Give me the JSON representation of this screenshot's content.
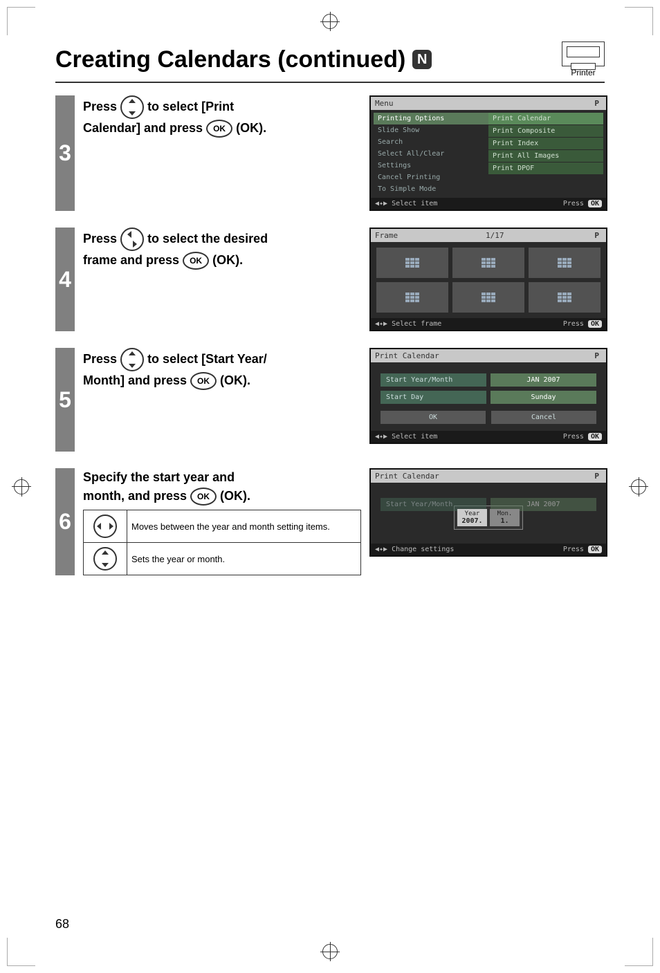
{
  "title": "Creating Calendars (continued)",
  "badge": "N",
  "printer_label": "Printer",
  "page_number": "68",
  "steps": {
    "s3": {
      "num": "3",
      "line1_a": "Press ",
      "line1_b": " to select [Print",
      "line2_a": "Calendar] and press ",
      "line2_b": " (OK).",
      "ok_inner": "OK"
    },
    "s4": {
      "num": "4",
      "line1_a": "Press ",
      "line1_b": " to select the desired",
      "line2_a": "frame and press ",
      "line2_b": " (OK).",
      "ok_inner": "OK"
    },
    "s5": {
      "num": "5",
      "line1_a": "Press ",
      "line1_b": " to select [Start Year/",
      "line2_a": "Month] and press ",
      "line2_b": " (OK).",
      "ok_inner": "OK"
    },
    "s6": {
      "num": "6",
      "line1": "Specify the start year and",
      "line2_a": "month, and press ",
      "line2_b": " (OK).",
      "ok_inner": "OK",
      "row1": "Moves between the year and month setting items.",
      "row2": "Sets the year or month."
    }
  },
  "shots": {
    "menu": {
      "header": "Menu",
      "p": "P",
      "left": [
        "Printing Options",
        "Slide Show",
        "Search",
        "Select All/Clear",
        "Settings",
        "Cancel Printing",
        "To Simple Mode"
      ],
      "right": [
        "Print Calendar",
        "Print Composite",
        "Print Index",
        "Print All Images",
        "Print DPOF"
      ],
      "footer_left": "◀✦▶ Select item",
      "footer_right_a": "Press",
      "footer_right_b": "OK"
    },
    "frame": {
      "header": "Frame",
      "count": "1/17",
      "p": "P",
      "footer_left": "◀✦▶ Select frame",
      "footer_right_a": "Press",
      "footer_right_b": "OK"
    },
    "pc1": {
      "header": "Print Calendar",
      "p": "P",
      "r1_lbl": "Start Year/Month",
      "r1_val": "JAN 2007",
      "r2_lbl": "Start Day",
      "r2_val": "Sunday",
      "ok": "OK",
      "cancel": "Cancel",
      "footer_left": "◀✦▶ Select item",
      "footer_right_a": "Press",
      "footer_right_b": "OK"
    },
    "pc2": {
      "header": "Print Calendar",
      "p": "P",
      "dim_lbl": "Start Year/Month",
      "dim_val": "JAN 2007",
      "year_lbl": "Year",
      "year_val": "2007.",
      "mon_lbl": "Mon.",
      "mon_val": "1.",
      "footer_left": "◀✦▶ Change settings",
      "footer_right_a": "Press",
      "footer_right_b": "OK"
    }
  }
}
